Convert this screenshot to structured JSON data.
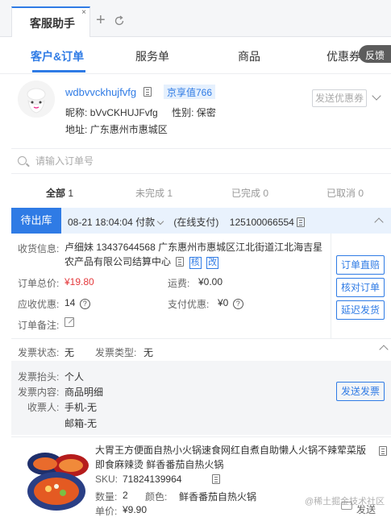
{
  "tabs": {
    "active_label": "客服助手",
    "close_glyph": "×",
    "add_glyph": "+"
  },
  "nav": {
    "items": [
      "客户&订单",
      "服务单",
      "商品",
      "优惠券"
    ],
    "feedback": "反馈"
  },
  "customer": {
    "username": "wdbvvckhujfvfg",
    "jd_value": "京享值766",
    "nickname_label": "昵称:",
    "nickname": "bVvCKHUJFvfg",
    "gender_label": "性别:",
    "gender": "保密",
    "address_label": "地址:",
    "address": "广东惠州市惠城区",
    "coupon_button": "发送优惠券"
  },
  "search": {
    "placeholder": "请输入订单号"
  },
  "filters": [
    {
      "label": "全部",
      "count": "1"
    },
    {
      "label": "未完成",
      "count": "1"
    },
    {
      "label": "已完成",
      "count": "0"
    },
    {
      "label": "已取消",
      "count": "0"
    }
  ],
  "order": {
    "status": "待出库",
    "time": "08-21 18:04:04 付款",
    "pay_method": "(在线支付)",
    "order_id": "125100066554",
    "receiver_label": "收货信息:",
    "receiver": "卢细妹 13437644568 广东惠州市惠城区江北街道江北海吉星农产品有限公司结算中心",
    "tag_verify": "核",
    "tag_edit": "改",
    "total_label": "订单总价:",
    "total": "¥19.80",
    "shipping_label": "运费:",
    "shipping": "¥0.00",
    "discount_label": "应收优惠:",
    "discount": "14",
    "pay_discount_label": "支付优惠:",
    "pay_discount": "¥0",
    "note_label": "订单备注:",
    "buttons": [
      "订单直赔",
      "核对订单",
      "延迟发货"
    ]
  },
  "invoice": {
    "status_label": "发票状态:",
    "status": "无",
    "type_label": "发票类型:",
    "type": "无",
    "title_label": "发票抬头:",
    "title": "个人",
    "content_label": "发票内容:",
    "content": "商品明细",
    "receiver_label": "收票人:",
    "phone": "手机-无",
    "email": "邮箱-无",
    "send_button": "发送发票"
  },
  "product": {
    "title": "大胃王方便面自热小火锅速食网红自煮自助懒人火锅不辣荤菜版 即食麻辣烫 鲜香番茄自热火锅",
    "sku_label": "SKU:",
    "sku": "71824139964",
    "qty_label": "数量:",
    "qty": "2",
    "color_label": "颜色:",
    "color": "鲜香番茄自热火锅",
    "price_label": "单价:",
    "price": "¥9.90",
    "send": "发送",
    "watermark": "@稀土掘金技术社区"
  },
  "colors": {
    "accent": "#2f7be5",
    "price_red": "#e4393c"
  }
}
